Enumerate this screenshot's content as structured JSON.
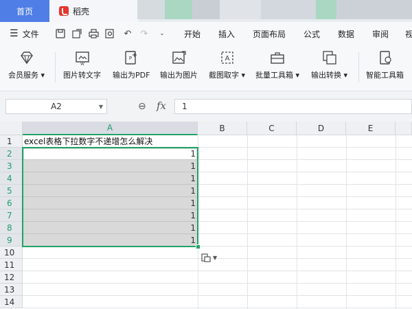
{
  "tabs": {
    "home": "首页",
    "doc": "稻壳"
  },
  "menu": {
    "file": "文件",
    "items": [
      "开始",
      "插入",
      "页面布局",
      "公式",
      "数据",
      "审阅",
      "视"
    ]
  },
  "ribbon": [
    {
      "label": "会员服务",
      "dropdown": true
    },
    {
      "label": "图片转文字",
      "dropdown": false
    },
    {
      "label": "输出为PDF",
      "dropdown": false
    },
    {
      "label": "输出为图片",
      "dropdown": false
    },
    {
      "label": "截图取字",
      "dropdown": true
    },
    {
      "label": "批量工具箱",
      "dropdown": true
    },
    {
      "label": "输出转换",
      "dropdown": true
    },
    {
      "label": "智能工具箱",
      "dropdown": false
    }
  ],
  "formula": {
    "cell_ref": "A2",
    "fx": "fx",
    "value": "1"
  },
  "sheet": {
    "columns": [
      "A",
      "B",
      "C",
      "D",
      "E"
    ],
    "rows": [
      "1",
      "2",
      "3",
      "4",
      "5",
      "6",
      "7",
      "8",
      "9",
      "10",
      "11",
      "12",
      "13",
      "14"
    ],
    "a1": "excel表格下拉数字不递增怎么解决",
    "values": [
      "1",
      "1",
      "1",
      "1",
      "1",
      "1",
      "1",
      "1"
    ]
  },
  "colors": {
    "accent": "#21a366",
    "tab_blue": "#4f7fe6",
    "brand_red": "#e5362f"
  }
}
